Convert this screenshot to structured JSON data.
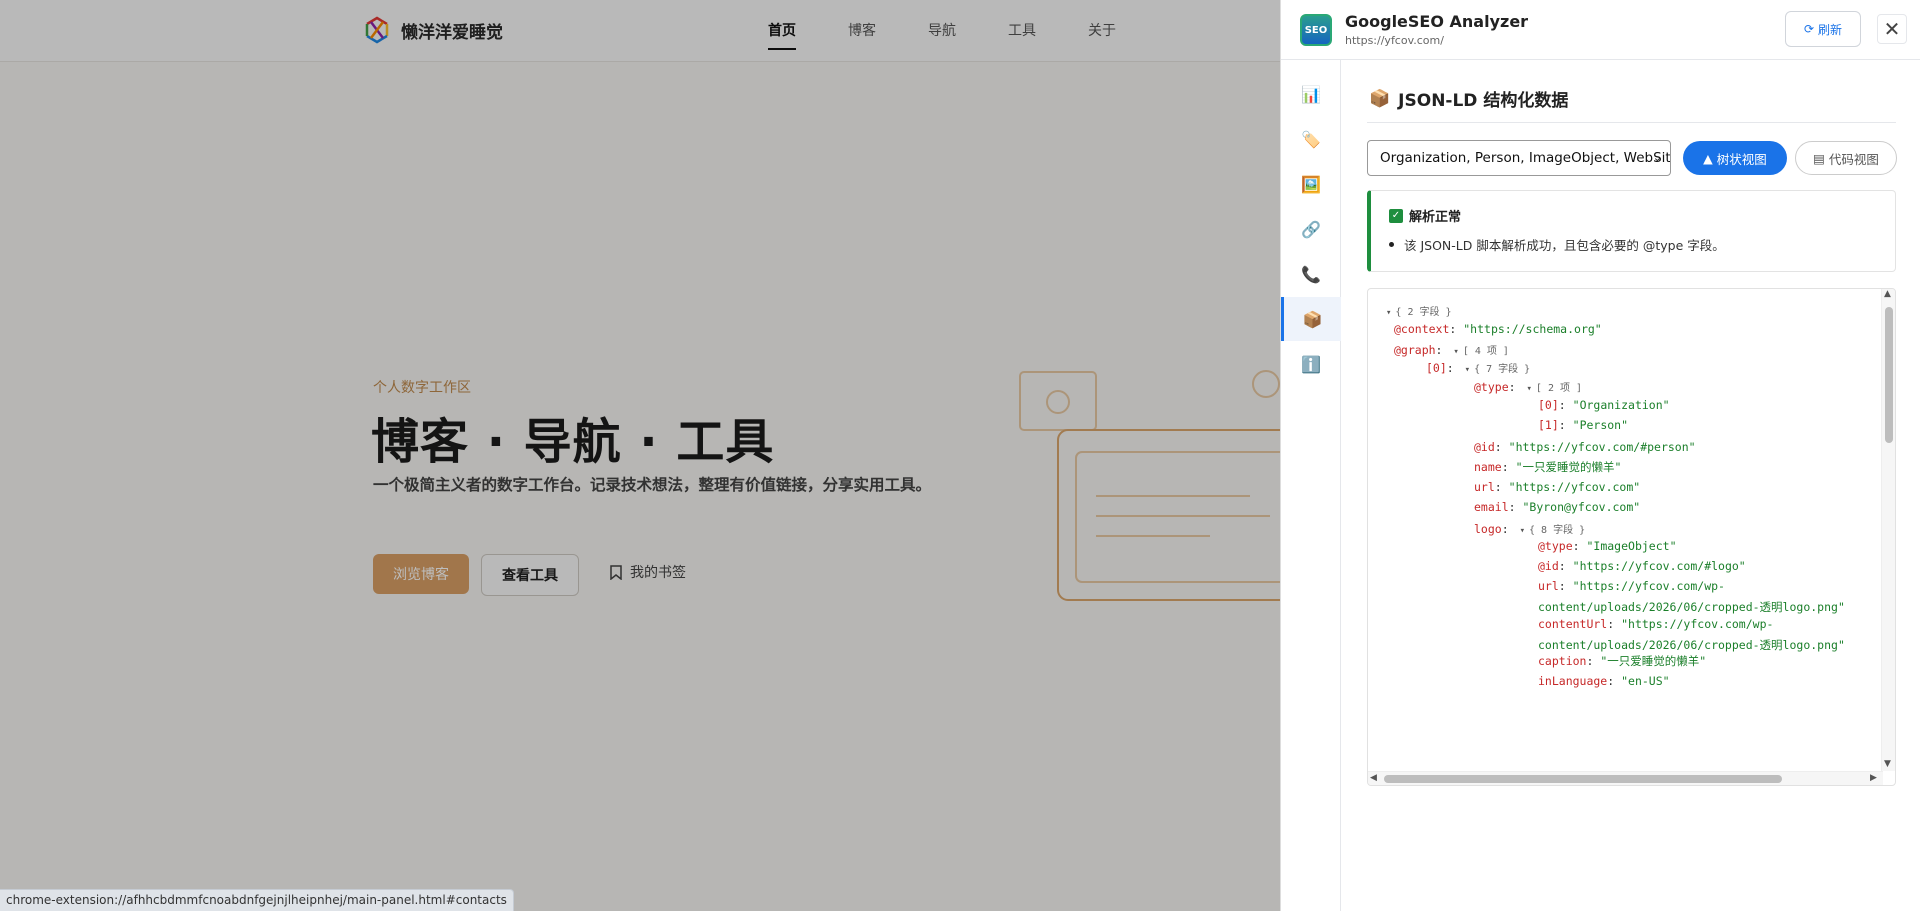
{
  "site": {
    "brand": "懒洋洋爱睡觉",
    "nav": [
      "首页",
      "博客",
      "导航",
      "工具",
      "关于"
    ],
    "hero": {
      "eyebrow": "个人数字工作区",
      "title": "博客 · 导航 · 工具",
      "desc": "一个极简主义者的数字工作台。记录技术想法，整理有价值链接，分享实用工具。",
      "btn_primary": "浏览博客",
      "btn_secondary": "查看工具",
      "bookmark": "我的书签"
    },
    "status_url": "chrome-extension://afhhcbdmmfcnoabdnfgejnjlheipnhej/main-panel.html#contacts"
  },
  "panel": {
    "icon_text": "SEO",
    "title": "GoogleSEO Analyzer",
    "url": "https://yfcov.com/",
    "refresh": "刷新",
    "close": "✕",
    "rail": [
      "📊",
      "🏷️",
      "🖼️",
      "🔗",
      "📞",
      "📦",
      "ℹ️"
    ],
    "section_icon": "📦",
    "section_title": "JSON-LD 结构化数据",
    "select_value": "Organization, Person, ImageObject, WebSite",
    "tree_view": "树状视图",
    "code_view": "代码视图",
    "status_title": "解析正常",
    "status_msg": "该 JSON-LD 脚本解析成功，且包含必要的 @type 字段。",
    "tree": [
      {
        "indent": 14,
        "toggle": true,
        "key": "",
        "val": "",
        "meta": "{ 2 字段 }"
      },
      {
        "indent": 26,
        "key": "@context",
        "val": "\"https://schema.org\""
      },
      {
        "indent": 26,
        "toggle": true,
        "key": "@graph",
        "val": "",
        "meta": "[ 4 项 ]"
      },
      {
        "indent": 58,
        "toggle": true,
        "key": "[0]",
        "val": "",
        "meta": "{ 7 字段 }"
      },
      {
        "indent": 106,
        "toggle": true,
        "key": "@type",
        "val": "",
        "meta": "[ 2 项 ]"
      },
      {
        "indent": 170,
        "key": "[0]",
        "val": "\"Organization\""
      },
      {
        "indent": 170,
        "key": "[1]",
        "val": "\"Person\""
      },
      {
        "indent": 106,
        "key": "@id",
        "val": "\"https://yfcov.com/#person\""
      },
      {
        "indent": 106,
        "key": "name",
        "val": "\"一只爱睡觉的懒羊\""
      },
      {
        "indent": 106,
        "key": "url",
        "val": "\"https://yfcov.com\""
      },
      {
        "indent": 106,
        "key": "email",
        "val": "\"Byron@yfcov.com\""
      },
      {
        "indent": 106,
        "toggle": true,
        "key": "logo",
        "val": "",
        "meta": "{ 8 字段 }"
      },
      {
        "indent": 170,
        "key": "@type",
        "val": "\"ImageObject\""
      },
      {
        "indent": 170,
        "key": "@id",
        "val": "\"https://yfcov.com/#logo\""
      },
      {
        "indent": 170,
        "key": "url",
        "val": "\"https://yfcov.com/wp-",
        "cont": "content/uploads/2026/06/cropped-透明logo.png\""
      },
      {
        "indent": 170,
        "key": "contentUrl",
        "val": "\"https://yfcov.com/wp-",
        "cont": "content/uploads/2026/06/cropped-透明logo.png\""
      },
      {
        "indent": 170,
        "key": "caption",
        "val": "\"一只爱睡觉的懒羊\""
      },
      {
        "indent": 170,
        "key": "inLanguage",
        "val": "\"en-US\""
      }
    ]
  }
}
